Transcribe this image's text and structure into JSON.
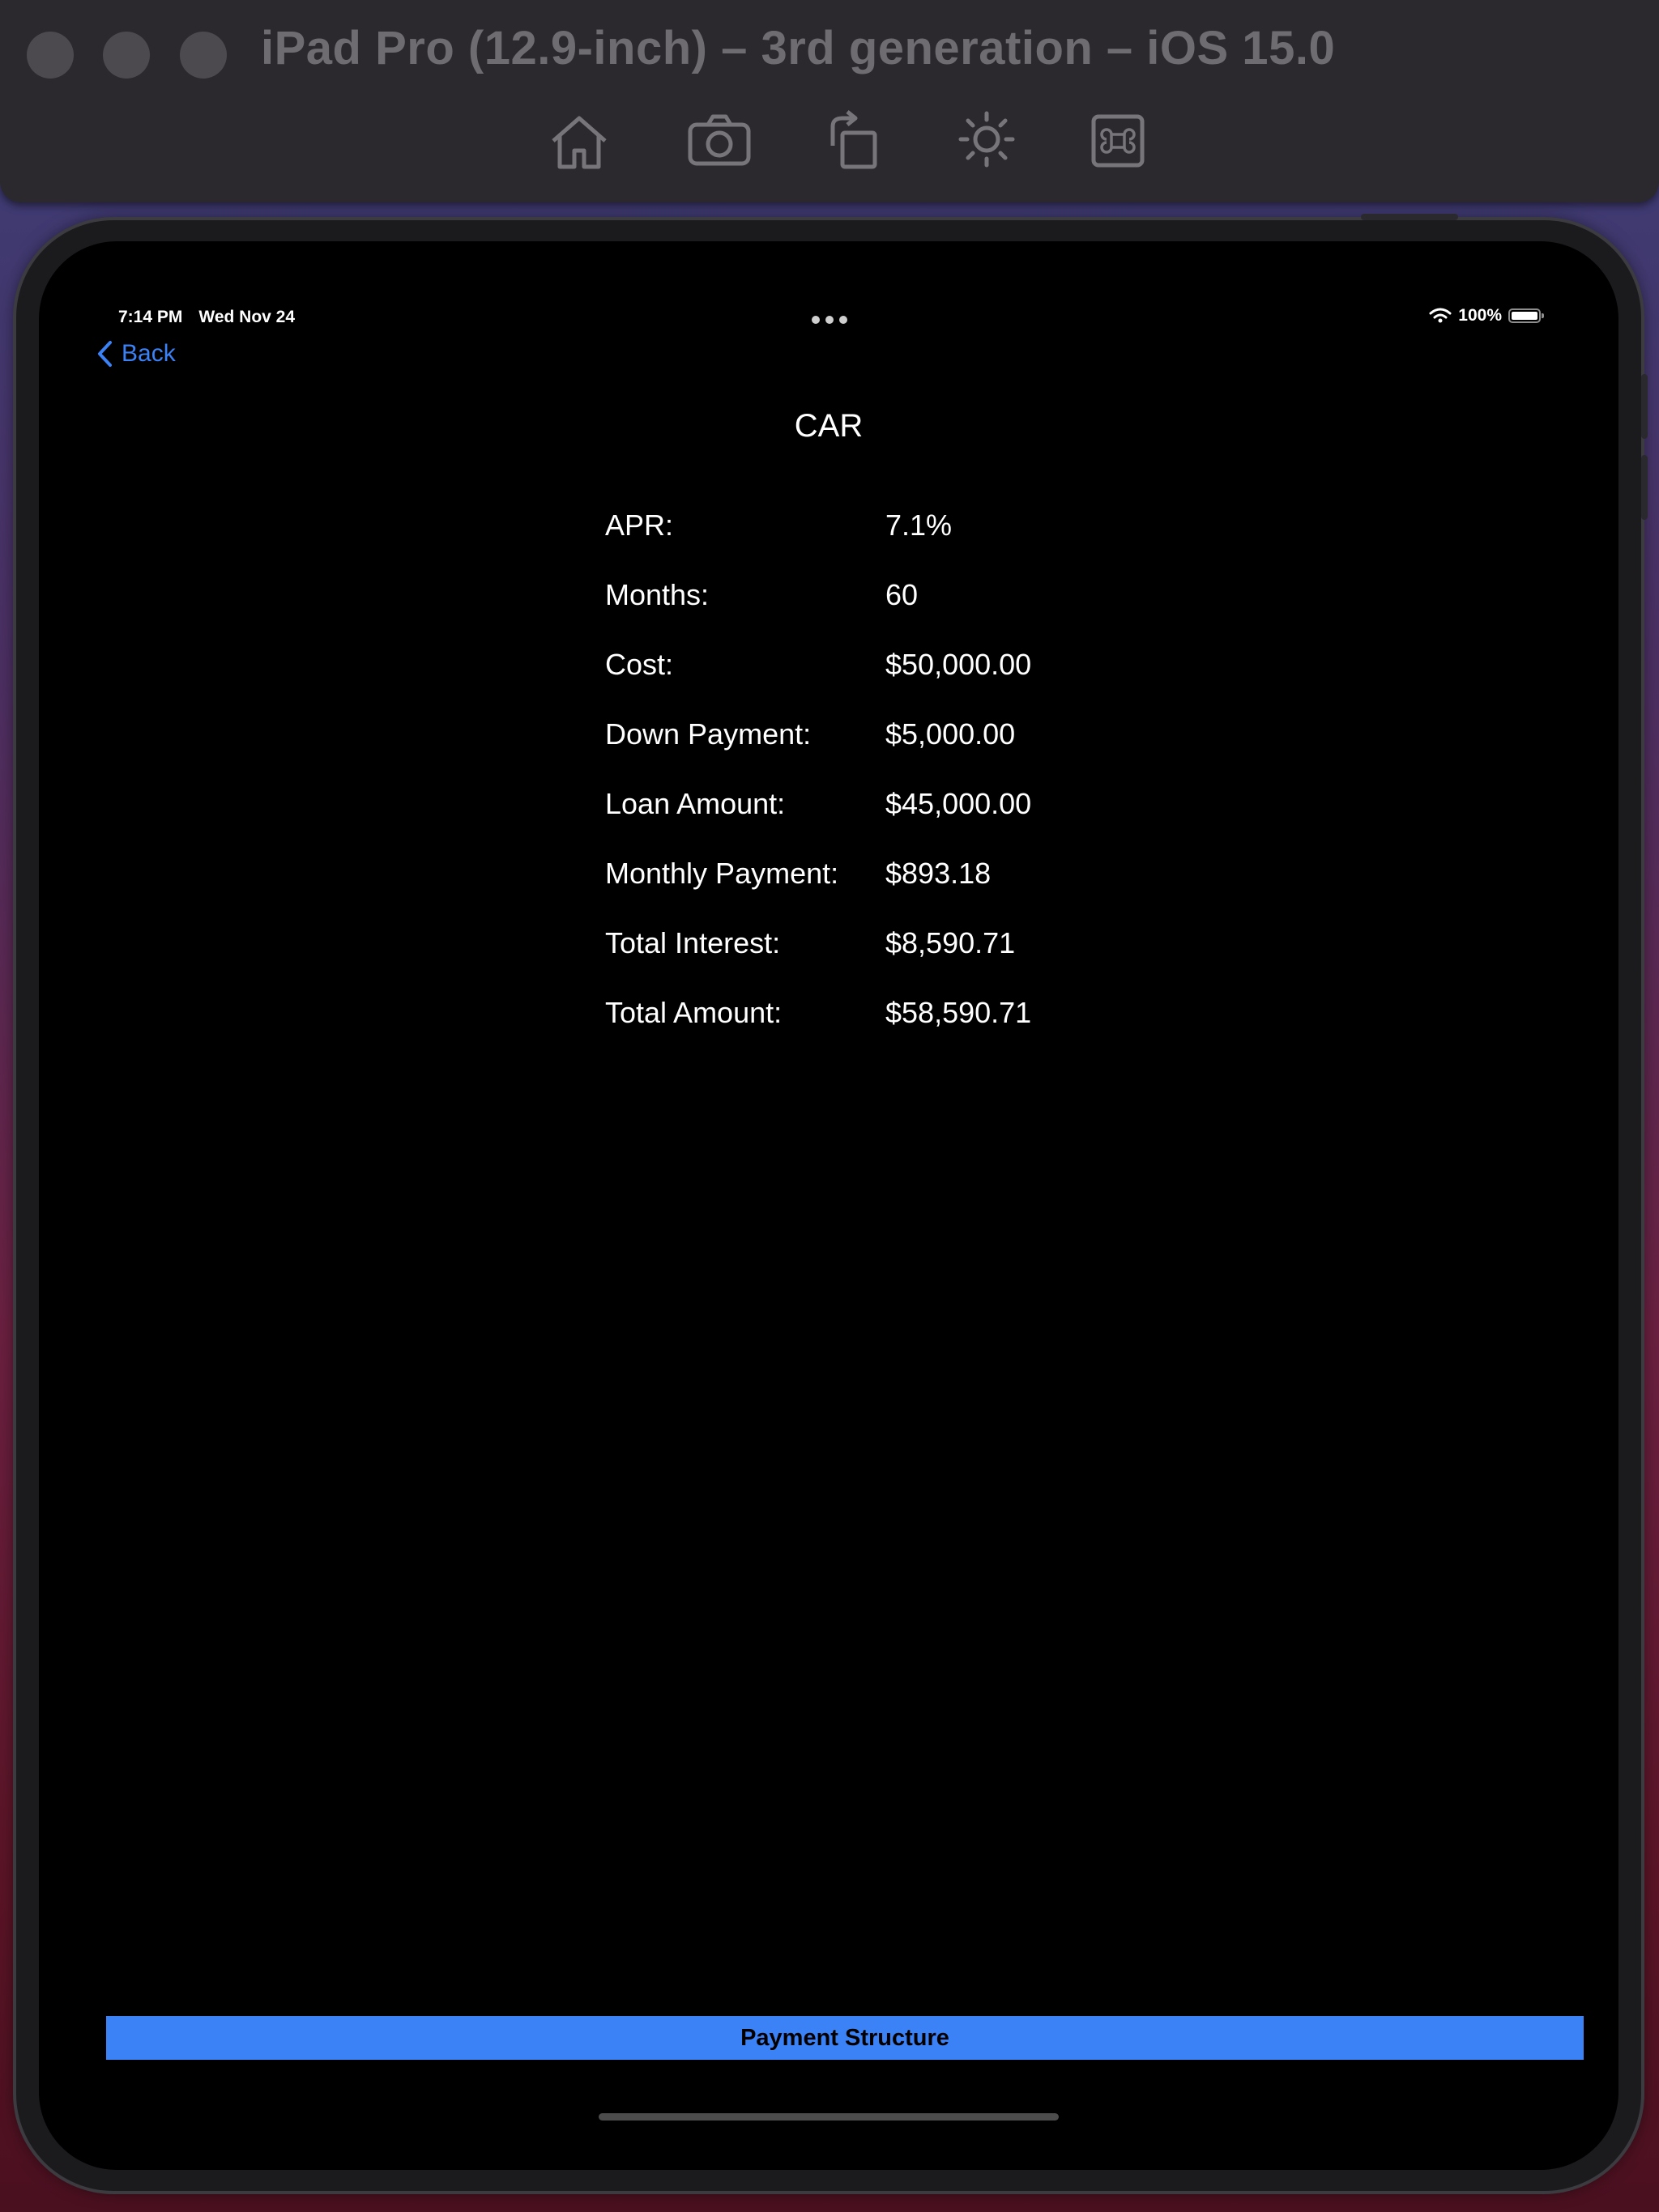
{
  "simulator": {
    "title": "iPad Pro (12.9-inch) – 3rd generation – iOS 15.0",
    "toolbar_icons": [
      "home-icon",
      "camera-icon",
      "rotate-icon",
      "brightness-icon",
      "command-icon"
    ]
  },
  "status_bar": {
    "time": "7:14 PM",
    "date": "Wed Nov 24",
    "battery": "100%"
  },
  "nav": {
    "back_label": "Back"
  },
  "screen": {
    "title": "CAR",
    "details": [
      {
        "label": "APR:",
        "value": "7.1%"
      },
      {
        "label": "Months:",
        "value": "60"
      },
      {
        "label": "Cost:",
        "value": "$50,000.00"
      },
      {
        "label": "Down Payment:",
        "value": "$5,000.00"
      },
      {
        "label": "Loan Amount:",
        "value": "$45,000.00"
      },
      {
        "label": "Monthly Payment:",
        "value": "$893.18"
      },
      {
        "label": "Total Interest:",
        "value": "$8,590.71"
      },
      {
        "label": "Total Amount:",
        "value": "$58,590.71"
      }
    ],
    "button_label": "Payment Structure"
  },
  "colors": {
    "accent": "#3b82f6",
    "screen_bg": "#000000",
    "simulator_bar": "#2b292d"
  }
}
